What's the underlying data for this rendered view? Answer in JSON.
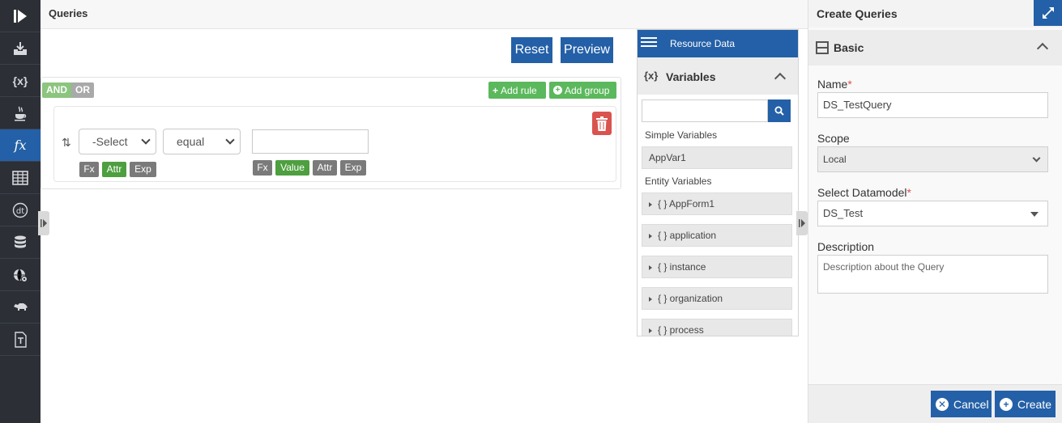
{
  "rail": {
    "items": [
      {
        "icon": "play-logo-icon",
        "active": false
      },
      {
        "icon": "download-tray-icon",
        "active": false
      },
      {
        "icon": "variables-icon",
        "text": "{x}",
        "active": false
      },
      {
        "icon": "java-cup-icon",
        "active": false
      },
      {
        "icon": "function-icon",
        "text": "fx",
        "active": true
      },
      {
        "icon": "table-icon",
        "active": false
      },
      {
        "icon": "datatable-icon",
        "text": "dt",
        "active": false
      },
      {
        "icon": "database-icon",
        "active": false
      },
      {
        "icon": "globe-gear-icon",
        "active": false
      },
      {
        "icon": "rhino-icon",
        "active": false
      },
      {
        "icon": "text-document-icon",
        "active": false
      }
    ]
  },
  "main": {
    "title": "Queries",
    "reset_label": "Reset",
    "preview_label": "Preview",
    "and_label": "AND",
    "or_label": "OR",
    "add_rule_label": "Add rule",
    "add_group_label": "Add group",
    "rule": {
      "field_value": "-Select",
      "operator_value": "equal",
      "value_input": "",
      "left_tags": [
        "Fx",
        "Attr",
        "Exp"
      ],
      "right_tags": [
        "Fx",
        "Value",
        "Attr",
        "Exp"
      ]
    }
  },
  "resource": {
    "header": "Resource Data",
    "variables_icon": "{x}",
    "variables_title": "Variables",
    "search_placeholder": "",
    "simple_label": "Simple Variables",
    "simple_items": [
      "AppVar1"
    ],
    "entity_label": "Entity Variables",
    "entity_items": [
      "{ } AppForm1",
      "{ } application",
      "{ } instance",
      "{ } organization",
      "{ } process"
    ]
  },
  "create": {
    "title": "Create Queries",
    "section_title": "Basic",
    "name_label": "Name",
    "name_value": "DS_TestQuery",
    "scope_label": "Scope",
    "scope_value": "Local",
    "datamodel_label": "Select Datamodel",
    "datamodel_value": "DS_Test",
    "description_label": "Description",
    "description_placeholder": "Description about the Query",
    "required_mark": "*",
    "cancel_label": "Cancel",
    "create_label": "Create"
  },
  "colors": {
    "primary": "#2460a7",
    "success": "#5cb85c",
    "danger": "#d9534f",
    "rail": "#2c2f36"
  }
}
